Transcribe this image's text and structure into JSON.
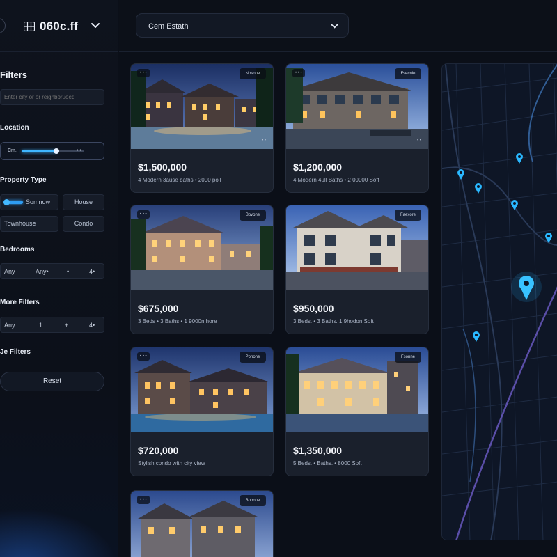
{
  "app": {
    "brand_name": "060c.ff",
    "search_select": "Cem Estath"
  },
  "filters": {
    "title": "Filters",
    "city_placeholder": "Enter city or or reighboruoed",
    "location_label": "Location",
    "location_prefix": "Cm.",
    "location_suffix": "• •",
    "location_value": 0.55,
    "property_type_label": "Property Type",
    "property_types": [
      "Somnow",
      "House",
      "Townhouse",
      "Condo"
    ],
    "bedrooms_label": "Bedrooms",
    "bedrooms": [
      "Any",
      "Any•",
      "•",
      "4•"
    ],
    "more_filters_label": "More Filters",
    "more_filters": [
      "Any",
      "1",
      "+",
      "4•"
    ],
    "extra_filters_label": "Je Filters",
    "reset_label": "Reset"
  },
  "listings": [
    {
      "price": "$1,500,000",
      "details": "4 Modern 3ause baths • 2000 poll",
      "badge_left": "• • •",
      "badge_right": "Nosone",
      "tag": "• •"
    },
    {
      "price": "$1,200,000",
      "details": "4 Modern 4ull Baths • 2 00000 Soff",
      "badge_left": "• • •",
      "badge_right": "Fsecnie",
      "tag": "• •"
    },
    {
      "price": "$675,000",
      "details": "3 Beds • 3 Baths • 1 9000n hore",
      "badge_left": "• • •",
      "badge_right": "Bovone",
      "tag": ""
    },
    {
      "price": "$950,000",
      "details": "3 Beds. • 3 Baths. 1 9hodon Soft",
      "badge_left": "",
      "badge_right": "Faexore",
      "tag": ""
    },
    {
      "price": "$720,000",
      "details": "Stylish condo with city view",
      "badge_left": "• • •",
      "badge_right": "Ponone",
      "tag": ""
    },
    {
      "price": "$1,350,000",
      "details": "5 Beds. • Baths. • 8000 Soft",
      "badge_left": "",
      "badge_right": "Fsonne",
      "tag": ""
    },
    {
      "price": "",
      "details": "",
      "badge_left": "• • •",
      "badge_right": "Booone",
      "tag": ""
    }
  ],
  "icons": {
    "brand": "grid-logo-icon",
    "brand_dropdown": "chevron-down-icon",
    "search_dropdown": "chevron-down-icon",
    "map_pin": "map-pin-icon"
  },
  "colors": {
    "background": "#0b0f18",
    "panel": "#1a202c",
    "accent": "#3fb6ff",
    "map_pin": "#2ab8ff"
  }
}
